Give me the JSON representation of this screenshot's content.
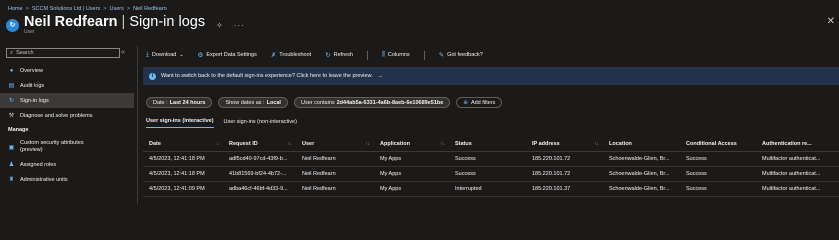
{
  "breadcrumb": [
    "Home",
    "SCCM Solutions Ltd | Users",
    "Users",
    "Neil Redfearn"
  ],
  "header": {
    "title_name": "Neil Redfearn",
    "title_page": "Sign-in logs",
    "subtitle": "User"
  },
  "sidebar": {
    "search_placeholder": "Search",
    "items": [
      {
        "label": "Overview",
        "icon": "user-icon"
      },
      {
        "label": "Audit logs",
        "icon": "audit-log-icon"
      },
      {
        "label": "Sign-in logs",
        "icon": "sign-in-icon",
        "active": true
      },
      {
        "label": "Diagnose and solve problems",
        "icon": "wrench-icon"
      }
    ],
    "section": "Manage",
    "manage_items": [
      {
        "label_line1": "Custom security attributes",
        "label_line2": "(preview)",
        "icon": "attributes-icon"
      },
      {
        "label": "Assigned roles",
        "icon": "roles-icon"
      },
      {
        "label": "Administrative units",
        "icon": "admin-units-icon"
      }
    ]
  },
  "toolbar": {
    "download": "Download",
    "export": "Export Data Settings",
    "troubleshoot": "Troubleshoot",
    "refresh": "Refresh",
    "columns": "Columns",
    "feedback": "Got feedback?"
  },
  "banner": {
    "text": "Want to switch back to the default sign-ins experience? Click here to leave the preview.",
    "arrow": "→"
  },
  "filters": {
    "date_label": "Date : ",
    "date_value": "Last 24 hours",
    "show_dates_label": "Show dates as : ",
    "show_dates_value": "Local",
    "user_label": "User contains ",
    "user_value": "2d44ab5a-6331-4a6b-8aeb-6e10689e51be",
    "add_filters": "Add filters"
  },
  "tabs": {
    "interactive": "User sign-ins (interactive)",
    "non_interactive": "User sign-ins (non-interactive)"
  },
  "table": {
    "headers": [
      "Date",
      "Request ID",
      "User",
      "Application",
      "Status",
      "IP address",
      "Location",
      "Conditional Access",
      "Authentication re..."
    ],
    "rows": [
      [
        "4/5/2023, 12:41:18 PM",
        "adf5cd40-97cd-43f9-b...",
        "Neil Redfearn",
        "My Apps",
        "Success",
        "185.220.101.72",
        "Schoenwalde-Glien, Br...",
        "Success",
        "Multifactor authenticat..."
      ],
      [
        "4/5/2023, 12:41:18 PM",
        "41b81569-bf24-4b72-...",
        "Neil Redfearn",
        "My Apps",
        "Success",
        "185.220.101.72",
        "Schoenwalde-Glien, Br...",
        "Success",
        "Multifactor authenticat..."
      ],
      [
        "4/5/2023, 12:41:09 PM",
        "adba46cf-46bf-4d33-9...",
        "Neil Redfearn",
        "My Apps",
        "Interrupted",
        "185.220.101.37",
        "Schoenwalde-Glien, Br...",
        "Success",
        "Multifactor authenticat..."
      ]
    ]
  },
  "colors": {
    "background": "#1b1a19",
    "accent": "#6cb8f6",
    "banner": "#22324a",
    "link": "#9cc3ef"
  }
}
